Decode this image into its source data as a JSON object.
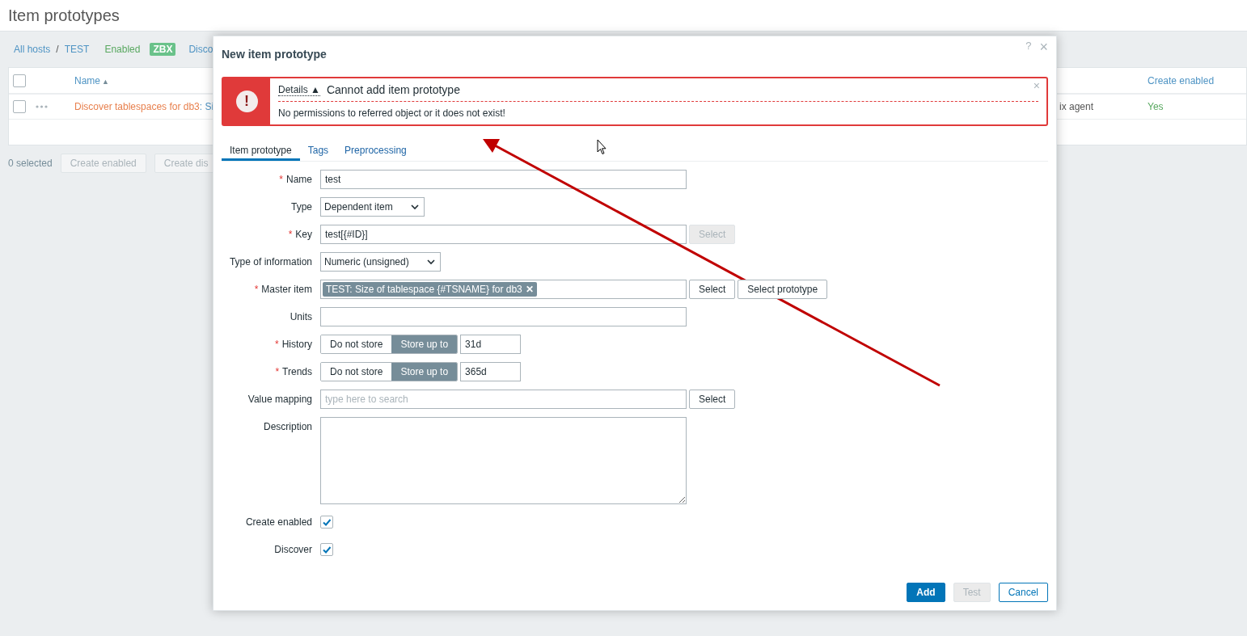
{
  "page": {
    "title": "Item prototypes"
  },
  "breadcrumbs": [
    {
      "text": "All hosts",
      "kind": "link"
    },
    {
      "text": "/",
      "kind": "separator"
    },
    {
      "text": "TEST",
      "kind": "link"
    },
    {
      "text": "Enabled",
      "kind": "status"
    },
    {
      "text": "ZBX",
      "kind": "badge"
    },
    {
      "text": "Disco",
      "kind": "link"
    }
  ],
  "table": {
    "header_checked": false,
    "name_column": {
      "label": "Name",
      "sort_mark": "▲"
    },
    "create_column": {
      "label": "Create enabled"
    },
    "rows": [
      {
        "checked": false,
        "name": "Discover tablespaces for db3",
        "name_tail": ": Si",
        "type": "ix agent",
        "create_enabled": "Yes"
      }
    ]
  },
  "footer": {
    "selected_count": "0 selected",
    "buttons": [
      "Create enabled",
      "Create dis"
    ]
  },
  "modal": {
    "title": "New item prototype",
    "help": "?",
    "close": "×",
    "error": {
      "icon": "!",
      "details": "Details",
      "details_mark": "▲",
      "title": "Cannot add item prototype",
      "message": "No permissions to referred object or it does not exist!",
      "close": "×"
    },
    "tabs": [
      {
        "label": "Item prototype",
        "selected": true
      },
      {
        "label": "Tags",
        "selected": false
      },
      {
        "label": "Preprocessing",
        "selected": false
      }
    ],
    "fields": [
      {
        "kind": "text",
        "label": "Name",
        "required_mark": "*",
        "value": "test"
      },
      {
        "kind": "select",
        "label": "Type",
        "value": "Dependent item"
      },
      {
        "kind": "text",
        "label": "Key",
        "required_mark": "*",
        "value": "test[{#ID}]",
        "buttons": [
          {
            "label": "Select",
            "disabled": true
          }
        ]
      },
      {
        "kind": "select",
        "label": "Type of information",
        "value": "Numeric (unsigned)"
      },
      {
        "kind": "multiselect",
        "label": "Master item",
        "required_mark": "*",
        "tag": "TEST: Size of tablespace {#TSNAME} for db3",
        "tag_remove": "✕",
        "buttons": [
          {
            "label": "Select",
            "disabled": false
          },
          {
            "label": "Select prototype",
            "disabled": false
          }
        ]
      },
      {
        "kind": "text",
        "label": "Units"
      },
      {
        "kind": "segmented",
        "label": "History",
        "required_mark": "*",
        "options": [
          {
            "label": "Do not store",
            "selected": false
          },
          {
            "label": "Store up to",
            "selected": true
          }
        ],
        "value": "31d"
      },
      {
        "kind": "segmented",
        "label": "Trends",
        "required_mark": "*",
        "options": [
          {
            "label": "Do not store",
            "selected": false
          },
          {
            "label": "Store up to",
            "selected": true
          }
        ],
        "value": "365d"
      },
      {
        "kind": "text",
        "label": "Value mapping",
        "placeholder": "type here to search",
        "buttons": [
          {
            "label": "Select",
            "disabled": false
          }
        ]
      },
      {
        "kind": "textarea",
        "label": "Description"
      },
      {
        "kind": "checkbox",
        "label": "Create enabled",
        "checked": true
      },
      {
        "kind": "checkbox",
        "label": "Discover",
        "checked": true
      }
    ],
    "buttons": [
      {
        "label": "Add",
        "kind": "primary"
      },
      {
        "label": "Test",
        "kind": "disabled"
      },
      {
        "label": "Cancel",
        "kind": "secondary"
      }
    ]
  }
}
